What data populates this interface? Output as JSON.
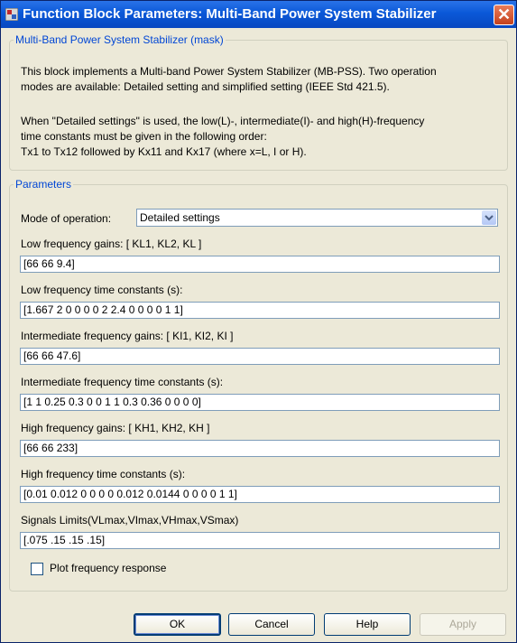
{
  "window": {
    "title": "Function Block Parameters: Multi-Band Power System Stabilizer"
  },
  "mask_group": {
    "legend": "Multi-Band Power System Stabilizer  (mask)",
    "description": [
      "This block implements a Multi-band Power System Stabilizer (MB-PSS). Two operation",
      "modes are available: Detailed setting and simplified setting (IEEE Std 421.5).",
      "",
      "When \"Detailed settings\" is used, the low(L)-, intermediate(I)- and high(H)-frequency",
      "time constants must be given in the following order:",
      "Tx1 to Tx12 followed by Kx11 and Kx17 (where x=L, I or H)."
    ]
  },
  "params": {
    "legend": "Parameters",
    "mode_label": "Mode of operation:",
    "mode_value": "Detailed settings",
    "fields": [
      {
        "label": "Low frequency gains: [ KL1, KL2, KL ]",
        "value": "[66 66 9.4]"
      },
      {
        "label": "Low frequency  time constants (s):",
        "value": "[1.667 2 0 0 0 0 2 2.4 0 0 0 0 1 1]"
      },
      {
        "label": "Intermediate frequency gains: [ KI1, KI2, KI ]",
        "value": "[66 66 47.6]"
      },
      {
        "label": "Intermediate frequency time constants (s):",
        "value": "[1 1 0.25 0.3 0 0 1 1 0.3 0.36 0 0 0 0]"
      },
      {
        "label": "High frequency gains: [ KH1, KH2, KH ]",
        "value": "[66 66 233]"
      },
      {
        "label": "High frequency time constants (s):",
        "value": "[0.01 0.012 0 0 0 0  0.012 0.0144 0 0 0 0 1 1]"
      },
      {
        "label": "Signals Limits(VLmax,VImax,VHmax,VSmax)",
        "value": "[.075 .15 .15 .15]"
      }
    ],
    "checkbox_label": "Plot frequency response"
  },
  "buttons": {
    "ok": "OK",
    "cancel": "Cancel",
    "help": "Help",
    "apply": "Apply"
  }
}
